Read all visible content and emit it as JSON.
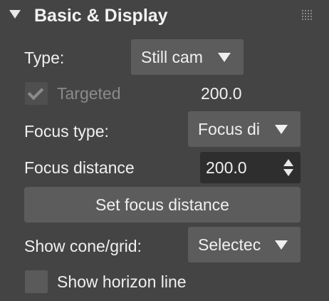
{
  "header": {
    "title": "Basic & Display",
    "collapse_icon": "triangle-down-icon",
    "handle_icon": "drag-grip-icon"
  },
  "type_row": {
    "label": "Type:",
    "value": "Still cam"
  },
  "targeted_row": {
    "label": "Targeted",
    "checked": true,
    "enabled": false,
    "value": "200.0"
  },
  "focus_type_row": {
    "label": "Focus type:",
    "value": "Focus di"
  },
  "focus_distance_row": {
    "label": "Focus distance",
    "value": "200.0"
  },
  "set_focus_button": {
    "label": "Set focus distance"
  },
  "cone_grid_row": {
    "label": "Show cone/grid:",
    "value": "Selectec"
  },
  "horizon_row": {
    "label": "Show horizon line",
    "checked": false
  },
  "colors": {
    "panel_bg": "#444444",
    "control_bg": "#5c5c5c",
    "spinner_bg": "#2e2e2e",
    "text": "#f0f0f0",
    "disabled_text": "#8a8a8a"
  }
}
